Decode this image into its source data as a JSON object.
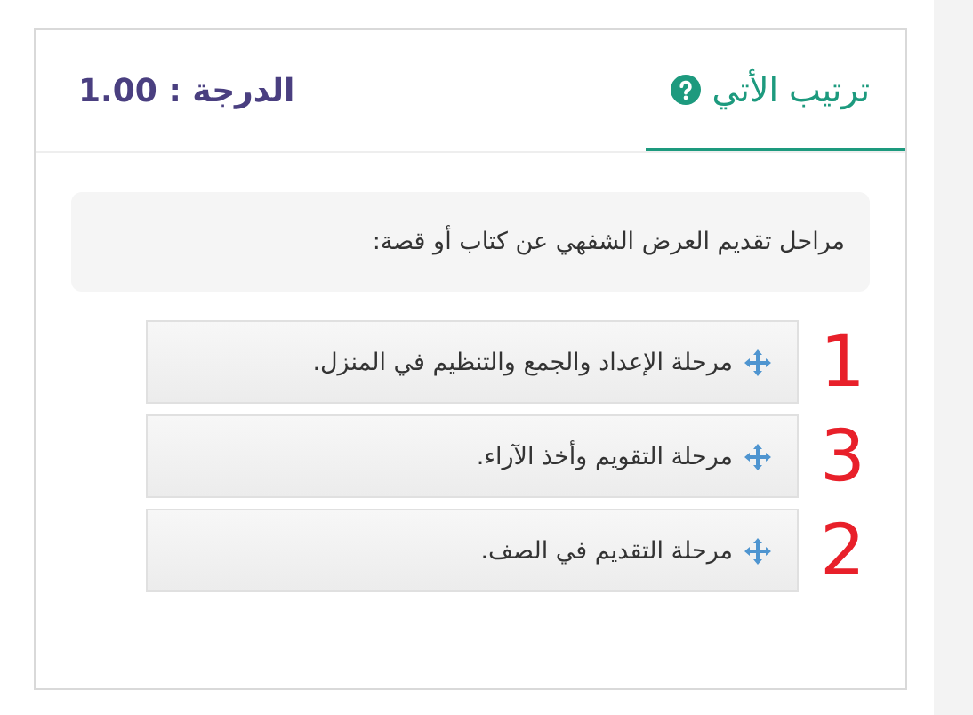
{
  "question": {
    "title": "ترتيب الأتي",
    "grade": "الدرجة : 1.00"
  },
  "prompt": "مراحل تقديم العرض الشفهي عن كتاب أو قصة:",
  "items": [
    {
      "text": "مرحلة الإعداد والجمع والتنظيم في المنزل.",
      "handwritten_mark": "1"
    },
    {
      "text": "مرحلة التقويم وأخذ الآراء.",
      "handwritten_mark": "3"
    },
    {
      "text": "مرحلة التقديم في الصف.",
      "handwritten_mark": "2"
    }
  ]
}
